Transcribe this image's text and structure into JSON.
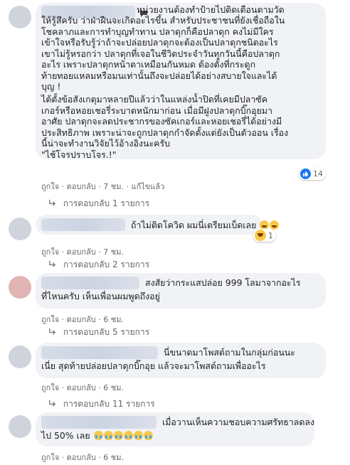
{
  "comments": [
    {
      "lines": [
        "      หน่วยงานต้องทำป้ายไปติดเตือนตามวัด",
        "ให้รู้สึครับ ว่าฝ่าฝืนจะเกิดอะไรขึ้น สำหรับประชาชนที่ยังเชื่อถือใน",
        "โชคลาภและการทำบุญทำทาน ปลาดุกก็คือปลาดุก คงไม่มีใคร",
        "เข้าใจหรือรับรู้ว่าถ้าจะปล่อยปลาดุกจะต้องเป็นปลาดุกชนิดอะไร",
        "เขาไม่รู้หรอกว่า ปลาดุกที่เจอในชีวิตประจำวันทุกวันนี้คือปลาดุก",
        "อะไร เพราะปลาดุกหน้าตาเหมือนกันหมด ต้องตั้งที่กระดูก",
        "ท้ายทอยแหลมหรือมนเท่านั้นถึงจะปล่อยได้อย่างสบายใจและได้",
        "บุญ !",
        "ไต้ตั้งข้อสังเกตุมาหลายปีแล้วว่าในแหล่งน้ำปิดที่เคยมีปลาซัค",
        "เกอร์หรือหอยเชอรี่ระบาดหนักมาก่อน เมื่อมีฝูงปลาดุกบิ๊กอุยมา",
        "อาศัย ปลาดุกจะลดประชากรของซัคเกอร์และหอยเชอรี่ได้อย่างมี",
        "ประสิทธิภาพ เพราะน่าจะถูกปลาดุกกำจัดตั้งแต่ยังเป็นตัวออน เรื่อง",
        "นี้น่าจะทำงานวิจัยไว้อ้างอิงนะครับ",
        "\"ไช้โจรปราบโจร.!\""
      ],
      "actions": {
        "like": "ถูกใจ",
        "reply": "ตอบกลับ",
        "time": "7 ชม.",
        "edited": "แก้ไขแล้ว"
      },
      "reaction_count": "14",
      "replies_label": "การตอบกลับ 1 รายการ"
    },
    {
      "lines": [
        "ถ้าไม่ติดโควิด ผมนี่เตรียมเบ็ดเลย"
      ],
      "actions": {
        "like": "ถูกใจ",
        "reply": "ตอบกลับ",
        "time": "7 ชม."
      },
      "reaction_count": "1",
      "replies_label": "การตอบกลับ 2 รายการ"
    },
    {
      "lines": [
        "สงสัยว่ากระแสปล่อย 999 โลมาจากอะไร",
        "ที่ไหนครับ เห็นเพื่อนผมพูดถึงอยู่"
      ],
      "actions": {
        "like": "ถูกใจ",
        "reply": "ตอบกลับ",
        "time": "6 ชม."
      },
      "replies_label": "การตอบกลับ 5 รายการ"
    },
    {
      "lines": [
        "นี่ขนาดมาโพสต์ถามในกลุ่มก่อนนะ",
        "เนี่ย สุดท้ายปล่อยปลาดุกบิ๊กอุย แล้วจะมาโพสต์ถามเพื่ออะไร"
      ],
      "actions": {
        "like": "ถูกใจ",
        "reply": "ตอบกลับ",
        "time": "6 ชม."
      },
      "replies_label": "การตอบกลับ 11 รายการ"
    },
    {
      "lines": [
        "เมื่อวานเห็นความชอบความศรัทธาลดลง",
        "ไป 50% เลย"
      ],
      "actions": {
        "like": "ถูกใจ",
        "reply": "ตอบกลับ",
        "time": "6 ชม."
      }
    }
  ],
  "colors": {
    "link": "#65676b",
    "bubble": "#f0f2f5",
    "like": "#1877f2",
    "haha": "#f7c948"
  },
  "icons": [
    "thumbs-up-icon",
    "laugh-icon",
    "reply-arrow-icon",
    "speech-bubble-icon",
    "grinning-emoji-icon",
    "crying-emoji-icon"
  ]
}
